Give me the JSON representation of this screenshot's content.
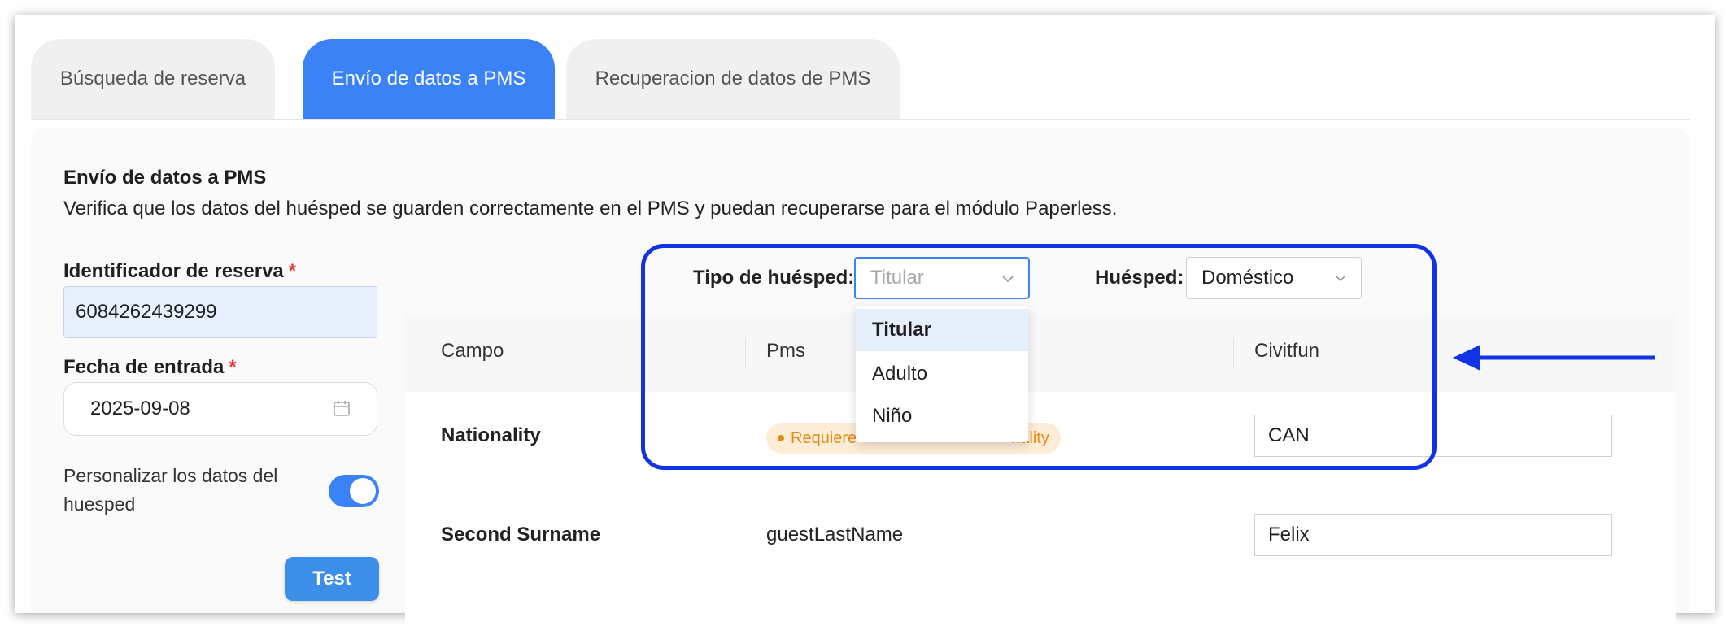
{
  "tabs": [
    {
      "label": "Búsqueda de reserva"
    },
    {
      "label": "Envío de datos a PMS"
    },
    {
      "label": "Recuperacion de datos de PMS"
    }
  ],
  "section": {
    "title": "Envío de datos a PMS",
    "description": "Verifica que los datos del huésped se guarden correctamente en el PMS y puedan recuperarse para el módulo Paperless."
  },
  "form": {
    "reservation_id_label": "Identificador de reserva",
    "reservation_id_value": "6084262439299",
    "entry_date_label": "Fecha de entrada",
    "entry_date_value": "2025-09-08",
    "required_mark": "*",
    "customize_label": "Personalizar los datos del huesped",
    "customize_enabled": true,
    "test_button": "Test"
  },
  "filters": {
    "guest_type_label": "Tipo de huésped:",
    "guest_type_placeholder": "Titular",
    "guest_label": "Huésped:",
    "guest_value": "Doméstico",
    "dropdown_options": [
      "Titular",
      "Adulto",
      "Niño"
    ],
    "dropdown_selected": "Titular"
  },
  "table": {
    "headers": [
      "Campo",
      "Pms",
      "Civitfun"
    ],
    "rows": [
      {
        "campo": "Nationality",
        "badge_visible_start": "Requiere",
        "badge_visible_end": "nality",
        "civitfun": "CAN"
      },
      {
        "campo": "Second Surname",
        "pms": "guestLastName",
        "civitfun": "Felix"
      }
    ]
  },
  "annotation": {
    "highlight_color": "#1033e6",
    "arrow_color": "#1033e6"
  },
  "colors": {
    "accent": "#3b82f6",
    "warning_bg": "#fdecd6",
    "warning_text": "#e58a12",
    "required": "#e53935"
  }
}
